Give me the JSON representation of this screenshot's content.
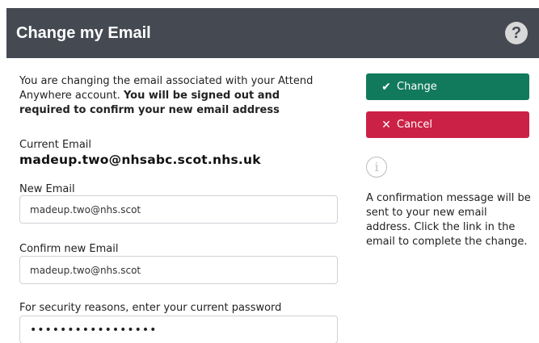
{
  "header": {
    "title": "Change my Email",
    "help_icon": "question-circle-icon",
    "help_glyph": "?"
  },
  "intro": {
    "text": "You are changing the email associated with your Attend Anywhere account. ",
    "bold": "You will be signed out and required to confirm your new email address"
  },
  "current_email": {
    "label": "Current Email",
    "value": "madeup.two@nhsabc.scot.nhs.uk"
  },
  "new_email": {
    "label": "New Email",
    "value": "madeup.two@nhs.scot"
  },
  "confirm_email": {
    "label": "Confirm new Email",
    "value": "madeup.two@nhs.scot"
  },
  "password": {
    "label": "For security reasons, enter your current password",
    "value": "•••••••••••••••••"
  },
  "actions": {
    "change_label": "Change",
    "change_icon": "checkmark-icon",
    "change_glyph": "✔",
    "cancel_label": "Cancel",
    "cancel_icon": "close-icon",
    "cancel_glyph": "✕"
  },
  "info": {
    "icon": "info-circle-icon",
    "icon_glyph": "i",
    "text": "A confirmation message will be sent to your new email address. Click the link in the email to complete the change."
  },
  "colors": {
    "header_bg": "#454a52",
    "change_bg": "#117a5c",
    "cancel_bg": "#cc2146"
  }
}
